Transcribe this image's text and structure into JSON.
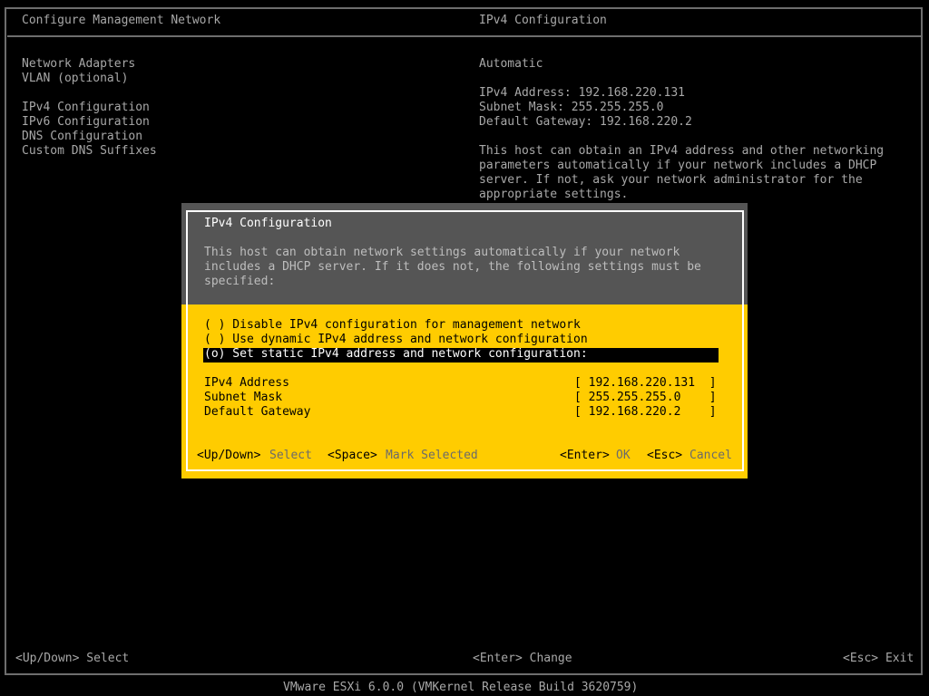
{
  "left_panel": {
    "title": "Configure Management Network",
    "menu": [
      {
        "label": "Network Adapters"
      },
      {
        "label": "VLAN (optional)"
      },
      {
        "label": "IPv4 Configuration"
      },
      {
        "label": "IPv6 Configuration"
      },
      {
        "label": "DNS Configuration"
      },
      {
        "label": "Custom DNS Suffixes"
      }
    ]
  },
  "right_panel": {
    "title": "IPv4 Configuration",
    "mode": "Automatic",
    "ipv4_address": "IPv4 Address: 192.168.220.131",
    "subnet_mask": "Subnet Mask: 255.255.255.0",
    "default_gateway": "Default Gateway: 192.168.220.2",
    "description": [
      "This host can obtain an IPv4 address and other networking",
      "parameters automatically if your network includes a DHCP",
      "server. If not, ask your network administrator for the",
      "appropriate settings."
    ]
  },
  "dialog": {
    "title": "IPv4 Configuration",
    "description": [
      "This host can obtain network settings automatically if your network",
      "includes a DHCP server. If it does not, the following settings must be",
      "specified:"
    ],
    "options": [
      {
        "label": "( ) Disable IPv4 configuration for management network",
        "selected": false
      },
      {
        "label": "( ) Use dynamic IPv4 address and network configuration",
        "selected": false
      },
      {
        "label": "(o) Set static IPv4 address and network configuration:",
        "selected": true
      }
    ],
    "fields": [
      {
        "label": "IPv4 Address",
        "value": "[ 192.168.220.131  ]"
      },
      {
        "label": "Subnet Mask",
        "value": "[ 255.255.255.0    ]"
      },
      {
        "label": "Default Gateway",
        "value": "[ 192.168.220.2    ]"
      }
    ],
    "hints": {
      "updown_key": "<Up/Down>",
      "updown_action": "Select",
      "space_key": "<Space>",
      "space_action": "Mark Selected",
      "enter_key": "<Enter>",
      "enter_action": "OK",
      "esc_key": "<Esc>",
      "esc_action": "Cancel"
    }
  },
  "footer": {
    "left": "<Up/Down> Select",
    "center": "<Enter> Change",
    "right": "<Esc> Exit",
    "version": "VMware ESXi 6.0.0 (VMKernel Release Build 3620759)"
  }
}
